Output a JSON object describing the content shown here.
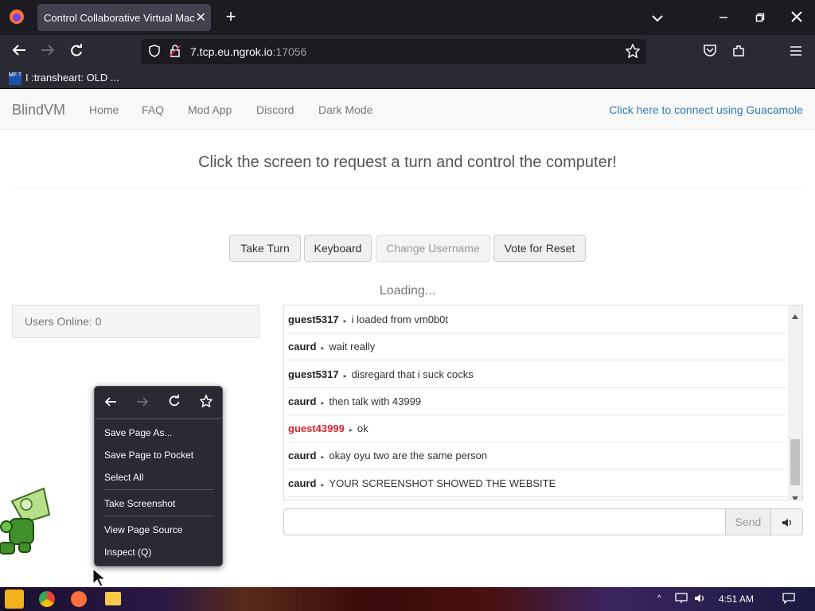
{
  "browser": {
    "tab_title": "Control Collaborative Virtual Machine",
    "tab_close": "✕",
    "new_tab": "+",
    "url_host": "7.tcp.eu.ngrok.io",
    "url_port": ":17056",
    "bookmark_label": "I :transheart: OLD ...",
    "bookmark_favicon_text": "MF T"
  },
  "site": {
    "brand": "BlindVM",
    "nav": [
      "Home",
      "FAQ",
      "Mod App",
      "Discord",
      "Dark Mode"
    ],
    "guac_link": "Click here to connect using Guacamole",
    "headline": "Click the screen to request a turn and control the computer!",
    "buttons": {
      "take_turn": "Take Turn",
      "keyboard": "Keyboard",
      "change_username": "Change Username",
      "vote_reset": "Vote for Reset"
    },
    "loading": "Loading...",
    "users_online": "Users Online: 0",
    "send": "Send"
  },
  "chat": {
    "messages": [
      {
        "user": "guest5317",
        "text": "i loaded from vm0b0t",
        "highlight": false
      },
      {
        "user": "caurd",
        "text": "wait really",
        "highlight": false
      },
      {
        "user": "guest5317",
        "text": "disregard that i suck cocks",
        "highlight": false
      },
      {
        "user": "caurd",
        "text": "then talk with 43999",
        "highlight": false
      },
      {
        "user": "guest43999",
        "text": "ok",
        "highlight": true
      },
      {
        "user": "caurd",
        "text": "okay oyu two are the same person",
        "highlight": false
      },
      {
        "user": "caurd",
        "text": "YOUR SCREENSHOT SHOWED THE WEBSITE",
        "highlight": false
      }
    ]
  },
  "context_menu": {
    "items": [
      "Save Page As...",
      "Save Page to Pocket",
      "Select All",
      "Take Screenshot",
      "View Page Source",
      "Inspect (Q)"
    ]
  },
  "taskbar": {
    "clock": "4:51 AM"
  },
  "colors": {
    "highlight_user": "#d9232e",
    "link": "#337ab7"
  }
}
